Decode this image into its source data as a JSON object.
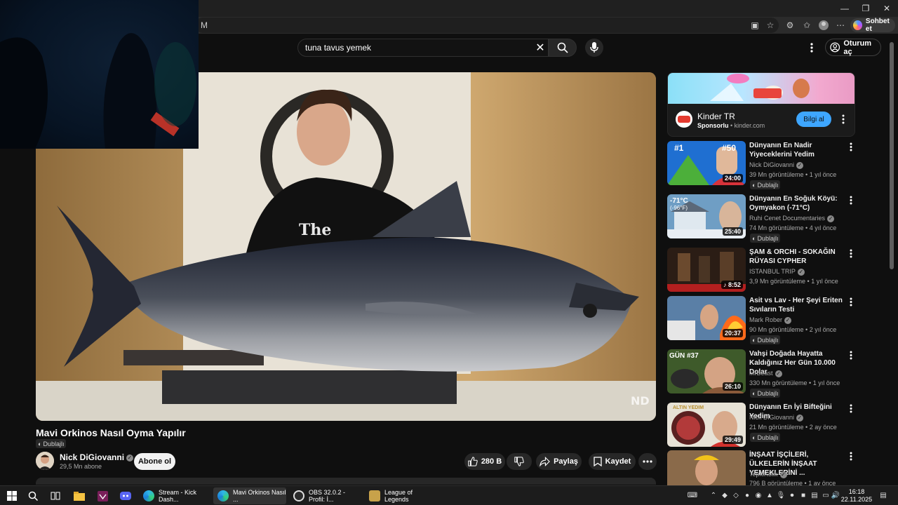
{
  "browser": {
    "url_fragment": "M",
    "copilot_label": "Sohbet et"
  },
  "youtube": {
    "search": {
      "value": "tuna tavus yemek"
    },
    "signin_label": "Oturum aç"
  },
  "video": {
    "watermark": "ND",
    "title": "Mavi Orkinos Nasıl Oyma Yapılır",
    "dub_label": "Dublajlı",
    "channel": "Nick DiGiovanni",
    "subscribers": "29,5 Mn abone",
    "subscribe_label": "Abone ol",
    "likes": "280 B",
    "share_label": "Paylaş",
    "save_label": "Kaydet"
  },
  "ad": {
    "title": "Kinder TR",
    "sponsored": "Sponsorlu",
    "domain": "kinder.com",
    "cta": "Bilgi al"
  },
  "recommendations": [
    {
      "title": "Dünyanın En Nadir Yiyeceklerini Yedim",
      "channel": "Nick DiGiovanni",
      "meta": "39 Mn görüntüleme • 1 yıl önce",
      "duration": "24:00",
      "dub": "Dublajlı",
      "thumb_text": [
        "#1",
        "#50"
      ]
    },
    {
      "title": "Dünyanın En Soğuk Köyü: Oymyakon (-71°C)",
      "channel": "Ruhi Cenet Documentaries",
      "meta": "74 Mn görüntüleme • 4 yıl önce",
      "duration": "25:40",
      "dub": "Dublajlı",
      "thumb_text": [
        "-71°C",
        "(-96°F)"
      ]
    },
    {
      "title": "ŞAM & ORCHI - SOKAĞIN RÜYASI CYPHER",
      "channel": "ISTANBUL TRIP",
      "meta": "3,9 Mn görüntüleme • 1 yıl önce",
      "duration": "8:52",
      "dub": "",
      "thumb_text": []
    },
    {
      "title": "Asit vs Lav - Her Şeyi Eriten Sıvıların Testi",
      "channel": "Mark Rober",
      "meta": "90 Mn görüntüleme • 2 yıl önce",
      "duration": "20:37",
      "dub": "Dublajlı",
      "thumb_text": []
    },
    {
      "title": "Vahşi Doğada Hayatta Kaldığınız Her Gün 10.000 Dolar",
      "channel": "MrBeast",
      "meta": "330 Mn görüntüleme • 1 yıl önce",
      "duration": "26:10",
      "dub": "Dublajlı",
      "thumb_text": [
        "GÜN #37"
      ]
    },
    {
      "title": "Dünyanın En İyi Bifteğini Yedim",
      "channel": "Nick DiGiovanni",
      "meta": "21 Mn görüntüleme • 2 ay önce",
      "duration": "29:49",
      "dub": "Dublajlı",
      "thumb_text": [
        "ALTIN YEDIM"
      ]
    },
    {
      "title": "İNŞAAT İŞÇİLERİ, ÜLKELERİN İNŞAAT YEMEKLERİNİ ...",
      "channel": "TepkiKolik",
      "meta": "796 B görüntüleme • 1 ay önce",
      "duration": "",
      "dub": "",
      "thumb_text": []
    }
  ],
  "taskbar": {
    "apps": [
      {
        "label": "Stream - Kick Dash..."
      },
      {
        "label": "Mavi Orkinos Nasıl ..."
      },
      {
        "label": "OBS 32.0.2 - Profil: İ..."
      },
      {
        "label": "League of Legends"
      }
    ],
    "time": "16:18",
    "date": "22.11.2025"
  }
}
